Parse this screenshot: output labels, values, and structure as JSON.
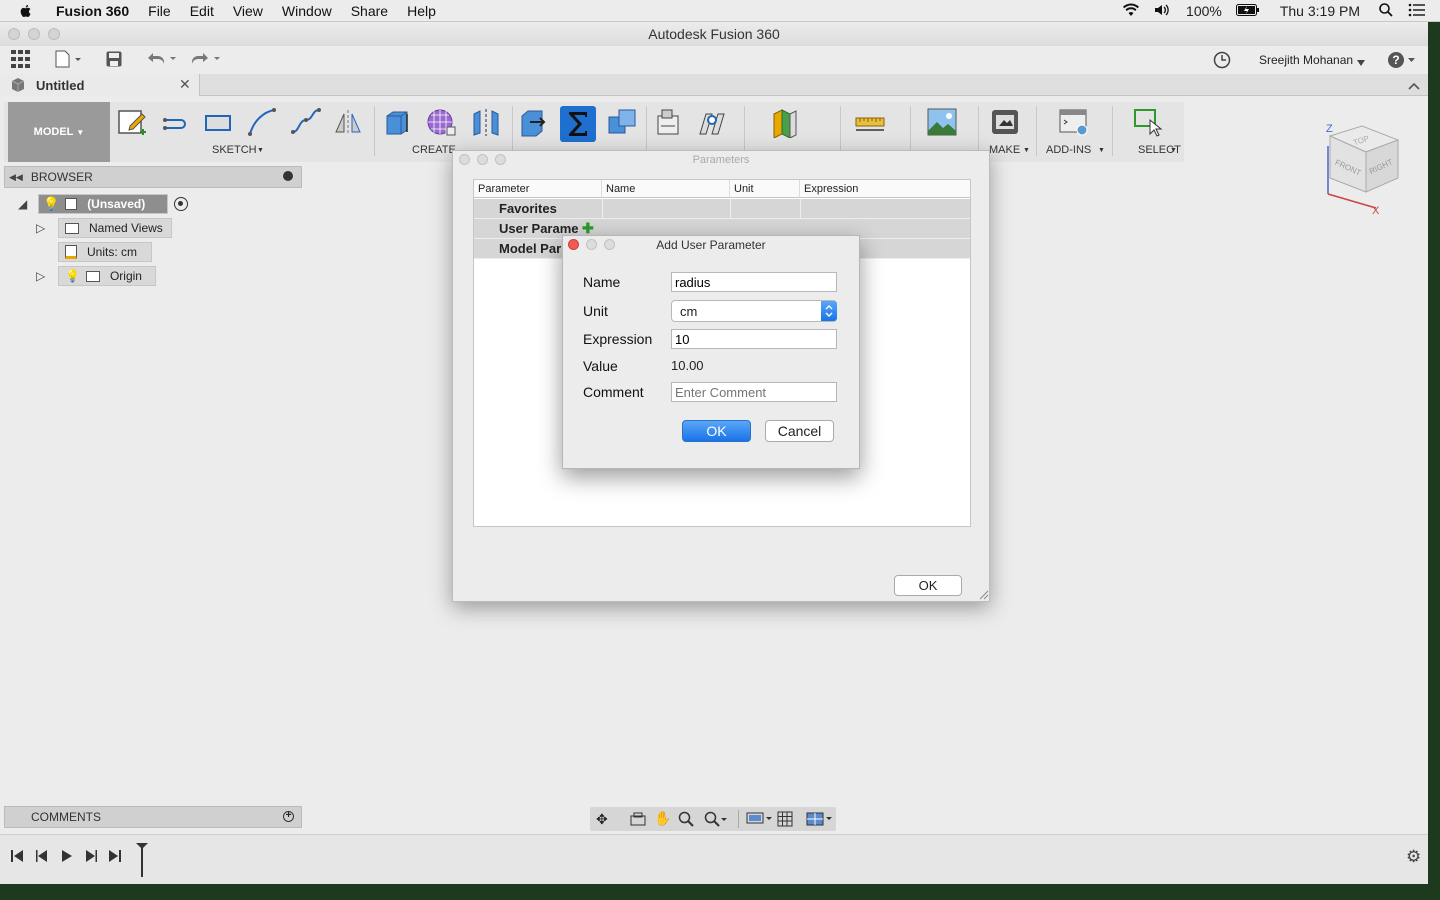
{
  "menubar": {
    "app_name": "Fusion 360",
    "items": [
      "File",
      "Edit",
      "View",
      "Window",
      "Share",
      "Help"
    ],
    "battery": "100%",
    "clock": "Thu 3:19 PM"
  },
  "window": {
    "title": "Autodesk Fusion 360",
    "user": "Sreejith Mohanan",
    "doc_tab": "Untitled"
  },
  "toolbar": {
    "mode": "MODEL",
    "groups": {
      "sketch": "SKETCH",
      "create": "CREATE",
      "make": "MAKE",
      "addins": "ADD-INS",
      "select": "SELECT"
    }
  },
  "browser": {
    "title": "BROWSER",
    "root": "(Unsaved)",
    "items": [
      "Named Views",
      "Units: cm",
      "Origin"
    ]
  },
  "comments": {
    "title": "COMMENTS"
  },
  "parameters_dialog": {
    "title": "Parameters",
    "columns": [
      "Parameter",
      "Name",
      "Unit",
      "Expression"
    ],
    "rows": [
      "Favorites",
      "User Parame",
      "Model Par"
    ],
    "ok_label": "OK"
  },
  "add_user_parameter": {
    "title": "Add User Parameter",
    "labels": {
      "name": "Name",
      "unit": "Unit",
      "expression": "Expression",
      "value": "Value",
      "comment": "Comment"
    },
    "name_value": "radius",
    "unit_value": "cm",
    "expression_value": "10",
    "computed_value": "10.00",
    "comment_placeholder": "Enter Comment",
    "ok_label": "OK",
    "cancel_label": "Cancel"
  },
  "viewcube": {
    "top": "TOP",
    "front": "FRONT",
    "right": "RIGHT",
    "z": "Z",
    "x": "X"
  },
  "colors": {
    "accent": "#1a74e8",
    "model_bg": "#9a9a9a",
    "selected_tool": "#1e6fcf"
  }
}
